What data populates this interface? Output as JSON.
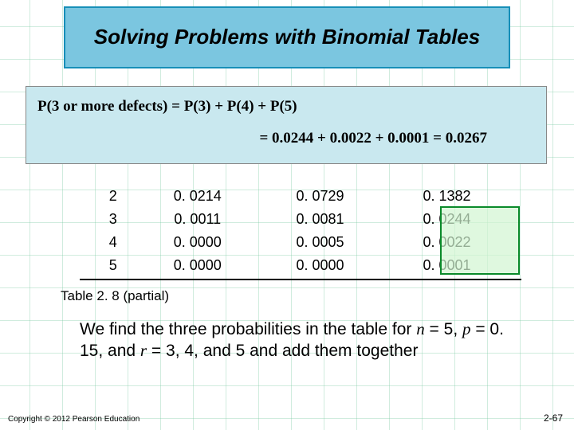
{
  "title": "Solving Problems with Binomial Tables",
  "equation": {
    "line1": "P(3 or more defects) = P(3) + P(4) + P(5)",
    "line2": "= 0.0244 + 0.0022 + 0.0001 = 0.0267"
  },
  "table": {
    "rows": [
      {
        "r": "2",
        "c1": "0. 0214",
        "c2": "0. 0729",
        "c3": "0. 1382"
      },
      {
        "r": "3",
        "c1": "0. 0011",
        "c2": "0. 0081",
        "c3": "0. 0244"
      },
      {
        "r": "4",
        "c1": "0. 0000",
        "c2": "0. 0005",
        "c3": "0. 0022"
      },
      {
        "r": "5",
        "c1": "0. 0000",
        "c2": "0. 0000",
        "c3": "0. 0001"
      }
    ]
  },
  "caption": "Table 2. 8 (partial)",
  "body": {
    "pre": "We find the three probabilities in the table for ",
    "n_sym": "n",
    "n_val": " = 5, ",
    "p_sym": "p",
    "p_val": " = 0. 15, and ",
    "r_sym": "r",
    "r_val": " = 3, 4, and 5 and add them together"
  },
  "footer": {
    "left": "Copyright © 2012 Pearson Education",
    "right": "2-67"
  },
  "colors": {
    "title_bg": "#7bc6e0",
    "title_border": "#178fb8",
    "eq_bg": "#c9e8ef",
    "highlight_border": "#0a8a2a"
  }
}
